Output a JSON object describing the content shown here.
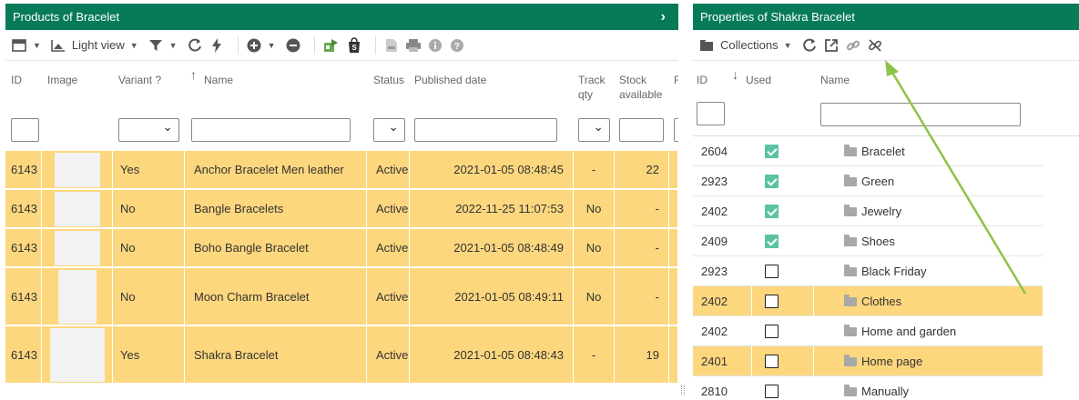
{
  "left": {
    "title": "Products of Bracelet",
    "toolbar": {
      "view_label": "Light view"
    },
    "columns": {
      "id": "ID",
      "image": "Image",
      "variant": "Variant ?",
      "name": "Name",
      "status": "Status",
      "published": "Published date",
      "track": [
        "Track",
        "qty"
      ],
      "stock": [
        "Stock",
        "available"
      ],
      "extra": "F"
    },
    "rows": [
      {
        "id": "6143",
        "variant": "Yes",
        "name": "Anchor Bracelet Men leather",
        "status": "Active",
        "published": "2021-01-05 08:48:45",
        "track": "-",
        "stock": "22"
      },
      {
        "id": "6143",
        "variant": "No",
        "name": "Bangle Bracelets",
        "status": "Active",
        "published": "2022-11-25 11:07:53",
        "track": "No",
        "stock": "-"
      },
      {
        "id": "6143",
        "variant": "No",
        "name": "Boho Bangle Bracelet",
        "status": "Active",
        "published": "2021-01-05 08:48:49",
        "track": "No",
        "stock": "-"
      },
      {
        "id": "6143",
        "variant": "No",
        "name": "Moon Charm Bracelet",
        "status": "Active",
        "published": "2021-01-05 08:49:11",
        "track": "No",
        "stock": "-"
      },
      {
        "id": "6143",
        "variant": "Yes",
        "name": "Shakra Bracelet",
        "status": "Active",
        "published": "2021-01-05 08:48:43",
        "track": "-",
        "stock": "19"
      }
    ]
  },
  "right": {
    "title": "Properties of Shakra Bracelet",
    "toolbar": {
      "collections_label": "Collections"
    },
    "columns": {
      "id": "ID",
      "used": "Used",
      "name": "Name"
    },
    "rows": [
      {
        "id": "2604",
        "used": true,
        "name": "Bracelet",
        "highlight": false
      },
      {
        "id": "2923",
        "used": true,
        "name": "Green",
        "highlight": false
      },
      {
        "id": "2402",
        "used": true,
        "name": "Jewelry",
        "highlight": false
      },
      {
        "id": "2409",
        "used": true,
        "name": "Shoes",
        "highlight": false
      },
      {
        "id": "2923",
        "used": false,
        "name": "Black Friday",
        "highlight": false
      },
      {
        "id": "2402",
        "used": false,
        "name": "Clothes",
        "highlight": true
      },
      {
        "id": "2402",
        "used": false,
        "name": "Home and garden",
        "highlight": false
      },
      {
        "id": "2401",
        "used": false,
        "name": "Home page",
        "highlight": true
      },
      {
        "id": "2810",
        "used": false,
        "name": "Manually",
        "highlight": false
      }
    ]
  },
  "colors": {
    "header": "#077a5a",
    "highlight": "#fdd77e",
    "checked": "#5cc2a4",
    "arrow": "#8dc34a"
  }
}
